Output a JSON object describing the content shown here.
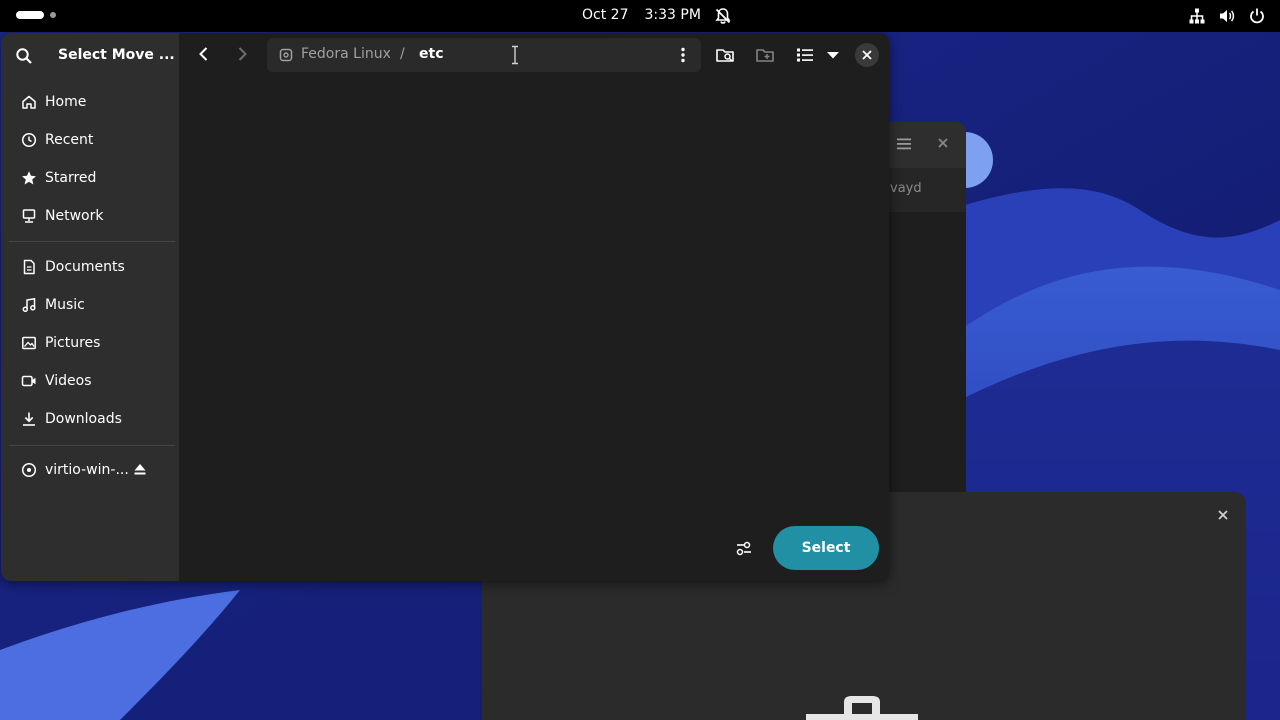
{
  "topbar": {
    "date": "Oct 27",
    "time": "3:33 PM",
    "icons": [
      "activities-icon",
      "notifications-off-icon",
      "network-icon",
      "volume-icon",
      "power-icon"
    ]
  },
  "dialog": {
    "title": "Select Move ...",
    "sidebar": {
      "items": [
        {
          "label": "Home",
          "icon": "home-icon"
        },
        {
          "label": "Recent",
          "icon": "clock-icon"
        },
        {
          "label": "Starred",
          "icon": "star-icon"
        },
        {
          "label": "Network",
          "icon": "network-icon"
        },
        {
          "label": "Documents",
          "icon": "document-icon"
        },
        {
          "label": "Music",
          "icon": "music-icon"
        },
        {
          "label": "Pictures",
          "icon": "picture-icon"
        },
        {
          "label": "Videos",
          "icon": "video-icon"
        },
        {
          "label": "Downloads",
          "icon": "download-icon"
        },
        {
          "label": "virtio-win-...",
          "icon": "disc-icon"
        }
      ]
    },
    "pathbar": {
      "root": "Fedora Linux",
      "separator": "/",
      "current": "etc"
    },
    "select_label": "Select",
    "accent_color": "#2190a4"
  },
  "background_window": {
    "tab_text": "vayd"
  }
}
